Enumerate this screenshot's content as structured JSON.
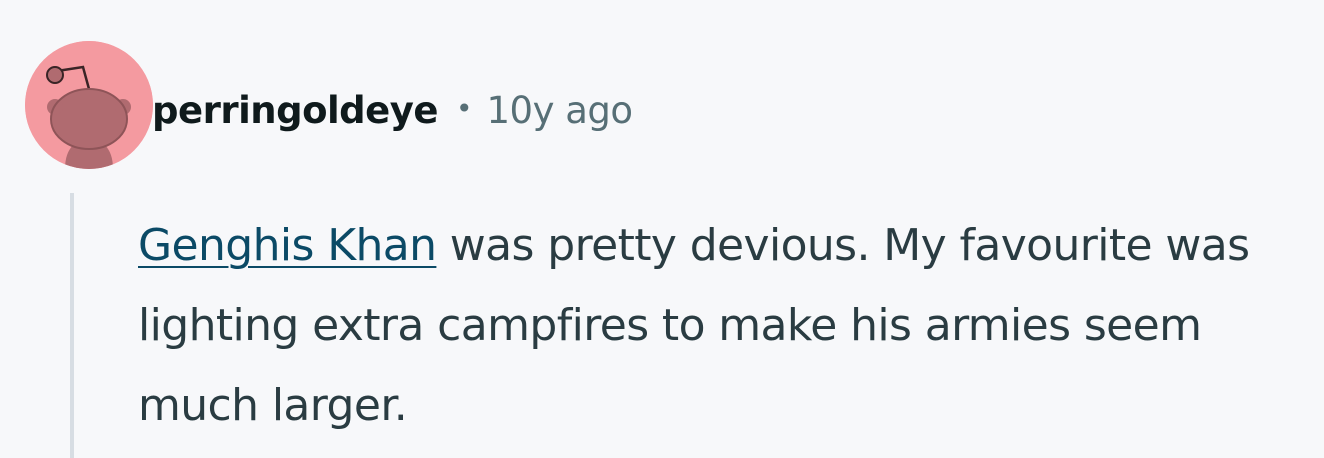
{
  "comment": {
    "author": "perringoldeye",
    "separator": "•",
    "timestamp": "10y ago",
    "avatar_icon": "snoo-avatar-icon",
    "avatar_bg": "#f49aa0",
    "body": {
      "link_text": "Genghis Khan",
      "text_after_link": " was pretty devious. My favourite was lighting extra campfires to make his armies seem much larger."
    },
    "colors": {
      "link": "#0b4a66",
      "text": "#2a3c42",
      "meta": "#576f76",
      "thread_line": "#d7dde3"
    }
  }
}
